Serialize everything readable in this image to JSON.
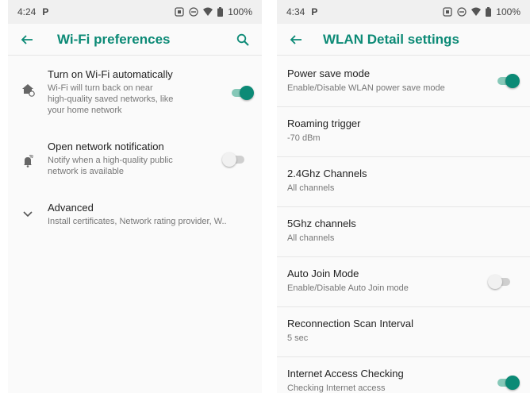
{
  "left": {
    "status": {
      "time": "4:24",
      "p_mark": "P",
      "battery": "100%"
    },
    "appbar": {
      "title": "Wi-Fi preferences"
    },
    "items": [
      {
        "title": "Turn on Wi-Fi automatically",
        "subtitle": "Wi-Fi will turn back on near\nhigh-quality saved networks, like\nyour home network",
        "toggle": "on",
        "icon": "home-wifi-icon"
      },
      {
        "title": "Open network notification",
        "subtitle": "Notify when a high-quality public\nnetwork is available",
        "toggle": "off",
        "icon": "notification-wifi-icon"
      },
      {
        "title": "Advanced",
        "subtitle": "Install certificates, Network rating provider, W..",
        "icon": "chevron-down-icon"
      }
    ]
  },
  "right": {
    "status": {
      "time": "4:34",
      "p_mark": "P",
      "battery": "100%"
    },
    "appbar": {
      "title": "WLAN Detail settings"
    },
    "rows": [
      {
        "title": "Power save mode",
        "subtitle": "Enable/Disable WLAN power save mode",
        "toggle": "on"
      },
      {
        "title": "Roaming trigger",
        "subtitle": "-70 dBm"
      },
      {
        "title": "2.4Ghz Channels",
        "subtitle": "All channels"
      },
      {
        "title": "5Ghz channels",
        "subtitle": "All channels"
      },
      {
        "title": "Auto Join Mode",
        "subtitle": "Enable/Disable Auto Join mode",
        "toggle": "off"
      },
      {
        "title": "Reconnection Scan Interval",
        "subtitle": "5 sec"
      },
      {
        "title": "Internet Access Checking",
        "subtitle": "Checking Internet access",
        "toggle": "on"
      }
    ]
  },
  "colors": {
    "accent": "#0c8a76",
    "accent_track": "#86c8b8",
    "statusbar": "#f0f0f0",
    "background": "#fafafa"
  }
}
